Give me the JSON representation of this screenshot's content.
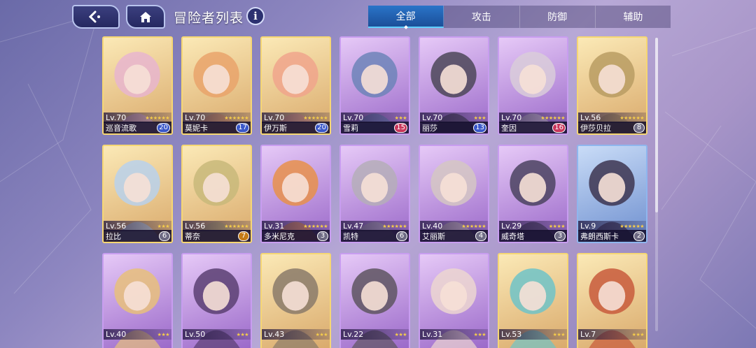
{
  "header": {
    "title": "冒险者列表",
    "info_label": "i",
    "back_icon": "back-arrow-icon",
    "home_icon": "home-icon"
  },
  "tabs": [
    {
      "label": "全部",
      "active": true
    },
    {
      "label": "攻击",
      "active": false
    },
    {
      "label": "防御",
      "active": false
    },
    {
      "label": "辅助",
      "active": false
    }
  ],
  "rows": [
    [
      {
        "level": "Lv.70",
        "name": "巡音流歌",
        "count": "20",
        "frame": "gold",
        "badge": "blue",
        "stars": "★★★★★★",
        "hue": "#e7b5cf"
      },
      {
        "level": "Lv.70",
        "name": "莫妮卡",
        "count": "17",
        "frame": "gold",
        "badge": "blue",
        "stars": "★★★★★★",
        "hue": "#e9a36b"
      },
      {
        "level": "Lv.70",
        "name": "伊万斯",
        "count": "20",
        "frame": "gold",
        "badge": "blue",
        "stars": "★★★★★★",
        "hue": "#f0a58c"
      },
      {
        "level": "Lv.70",
        "name": "雪莉",
        "count": "15",
        "frame": "purple",
        "badge": "red",
        "stars": "★★★",
        "hue": "#6d84b8"
      },
      {
        "level": "Lv.70",
        "name": "丽莎",
        "count": "13",
        "frame": "purple",
        "badge": "blue",
        "stars": "★★★",
        "hue": "#4c4658"
      },
      {
        "level": "Lv.70",
        "name": "奎因",
        "count": "16",
        "frame": "purple",
        "badge": "red",
        "stars": "★★★★★★",
        "hue": "#d9cdd9"
      },
      {
        "level": "Lv.56",
        "name": "伊莎贝拉",
        "count": "8",
        "frame": "gold",
        "badge": "grey",
        "stars": "★★★★★★",
        "hue": "#b89c63"
      }
    ],
    [
      {
        "level": "Lv.56",
        "name": "拉比",
        "count": "6",
        "frame": "gold",
        "badge": "grey",
        "stars": "★★★",
        "hue": "#b8d1ec"
      },
      {
        "level": "Lv.56",
        "name": "蒂奈",
        "count": "7",
        "frame": "gold",
        "badge": "orange",
        "stars": "★★★★★★",
        "hue": "#c8b87a"
      },
      {
        "level": "Lv.31",
        "name": "多米尼克",
        "count": "3",
        "frame": "purple",
        "badge": "grey",
        "stars": "★★★★★★",
        "hue": "#e7904b"
      },
      {
        "level": "Lv.47",
        "name": "凯特",
        "count": "6",
        "frame": "purple",
        "badge": "grey",
        "stars": "★★★★★★",
        "hue": "#b5aeb9"
      },
      {
        "level": "Lv.40",
        "name": "艾丽斯",
        "count": "4",
        "frame": "purple",
        "badge": "grey",
        "stars": "★★★★★★",
        "hue": "#d5c7c3"
      },
      {
        "level": "Lv.29",
        "name": "威奇塔",
        "count": "3",
        "frame": "purple",
        "badge": "grey",
        "stars": "★★★★",
        "hue": "#4b4360"
      },
      {
        "level": "Lv.9",
        "name": "弗朗西斯卡",
        "count": "2",
        "frame": "blue",
        "badge": "grey",
        "stars": "★★★★★★",
        "hue": "#3d3550"
      }
    ],
    [
      {
        "level": "Lv.40",
        "name": "",
        "count": "",
        "frame": "purple",
        "badge": "grey",
        "stars": "★★★",
        "hue": "#e7c07b"
      },
      {
        "level": "Lv.50",
        "name": "",
        "count": "",
        "frame": "purple",
        "badge": "grey",
        "stars": "★★★",
        "hue": "#5a3f72"
      },
      {
        "level": "Lv.43",
        "name": "",
        "count": "",
        "frame": "gold",
        "badge": "grey",
        "stars": "★★★",
        "hue": "#8a7a6a"
      },
      {
        "level": "Lv.22",
        "name": "",
        "count": "",
        "frame": "purple",
        "badge": "grey",
        "stars": "★★★",
        "hue": "#5e5560"
      },
      {
        "level": "Lv.31",
        "name": "",
        "count": "",
        "frame": "purple",
        "badge": "grey",
        "stars": "★★★",
        "hue": "#ecd6d0"
      },
      {
        "level": "Lv.53",
        "name": "",
        "count": "",
        "frame": "gold",
        "badge": "grey",
        "stars": "★★★",
        "hue": "#6fc3c8"
      },
      {
        "level": "Lv.7",
        "name": "",
        "count": "",
        "frame": "gold",
        "badge": "grey",
        "stars": "★★★",
        "hue": "#c85a3c"
      }
    ]
  ]
}
